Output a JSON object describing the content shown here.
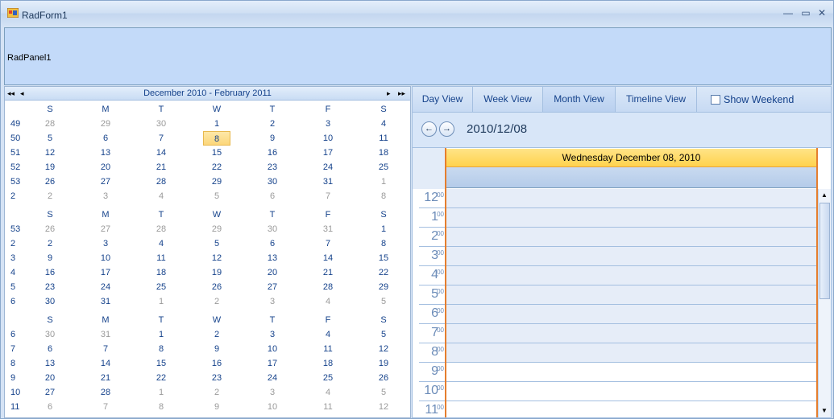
{
  "window": {
    "title": "RadForm1",
    "icons": {
      "app": "app-icon",
      "minimize": "minimize-icon",
      "maximize": "maximize-icon",
      "close": "close-icon"
    }
  },
  "panel": {
    "label": "RadPanel1"
  },
  "calendar": {
    "title": "December 2010 - February 2011",
    "nav": {
      "first": "◂◂",
      "prev": "◂",
      "next": "▸",
      "last": "▸▸"
    },
    "days_of_week": [
      "S",
      "M",
      "T",
      "W",
      "T",
      "F",
      "S"
    ],
    "months": [
      {
        "weeks": [
          {
            "wk": "49",
            "days": [
              [
                "28",
                1
              ],
              [
                "29",
                1
              ],
              [
                "30",
                1
              ],
              [
                "1",
                0
              ],
              [
                "2",
                0
              ],
              [
                "3",
                0
              ],
              [
                "4",
                0
              ]
            ]
          },
          {
            "wk": "50",
            "days": [
              [
                "5",
                0
              ],
              [
                "6",
                0
              ],
              [
                "7",
                0
              ],
              [
                "8",
                0
              ],
              [
                "9",
                0
              ],
              [
                "10",
                0
              ],
              [
                "11",
                0
              ]
            ]
          },
          {
            "wk": "51",
            "days": [
              [
                "12",
                0
              ],
              [
                "13",
                0
              ],
              [
                "14",
                0
              ],
              [
                "15",
                0
              ],
              [
                "16",
                0
              ],
              [
                "17",
                0
              ],
              [
                "18",
                0
              ]
            ]
          },
          {
            "wk": "52",
            "days": [
              [
                "19",
                0
              ],
              [
                "20",
                0
              ],
              [
                "21",
                0
              ],
              [
                "22",
                0
              ],
              [
                "23",
                0
              ],
              [
                "24",
                0
              ],
              [
                "25",
                0
              ]
            ]
          },
          {
            "wk": "53",
            "days": [
              [
                "26",
                0
              ],
              [
                "27",
                0
              ],
              [
                "28",
                0
              ],
              [
                "29",
                0
              ],
              [
                "30",
                0
              ],
              [
                "31",
                0
              ],
              [
                "1",
                1
              ]
            ]
          },
          {
            "wk": "2",
            "days": [
              [
                "2",
                1
              ],
              [
                "3",
                1
              ],
              [
                "4",
                1
              ],
              [
                "5",
                1
              ],
              [
                "6",
                1
              ],
              [
                "7",
                1
              ],
              [
                "8",
                1
              ]
            ]
          }
        ]
      },
      {
        "weeks": [
          {
            "wk": "53",
            "days": [
              [
                "26",
                1
              ],
              [
                "27",
                1
              ],
              [
                "28",
                1
              ],
              [
                "29",
                1
              ],
              [
                "30",
                1
              ],
              [
                "31",
                1
              ],
              [
                "1",
                0
              ]
            ]
          },
          {
            "wk": "2",
            "days": [
              [
                "2",
                0
              ],
              [
                "3",
                0
              ],
              [
                "4",
                0
              ],
              [
                "5",
                0
              ],
              [
                "6",
                0
              ],
              [
                "7",
                0
              ],
              [
                "8",
                0
              ]
            ]
          },
          {
            "wk": "3",
            "days": [
              [
                "9",
                0
              ],
              [
                "10",
                0
              ],
              [
                "11",
                0
              ],
              [
                "12",
                0
              ],
              [
                "13",
                0
              ],
              [
                "14",
                0
              ],
              [
                "15",
                0
              ]
            ]
          },
          {
            "wk": "4",
            "days": [
              [
                "16",
                0
              ],
              [
                "17",
                0
              ],
              [
                "18",
                0
              ],
              [
                "19",
                0
              ],
              [
                "20",
                0
              ],
              [
                "21",
                0
              ],
              [
                "22",
                0
              ]
            ]
          },
          {
            "wk": "5",
            "days": [
              [
                "23",
                0
              ],
              [
                "24",
                0
              ],
              [
                "25",
                0
              ],
              [
                "26",
                0
              ],
              [
                "27",
                0
              ],
              [
                "28",
                0
              ],
              [
                "29",
                0
              ]
            ]
          },
          {
            "wk": "6",
            "days": [
              [
                "30",
                0
              ],
              [
                "31",
                0
              ],
              [
                "1",
                1
              ],
              [
                "2",
                1
              ],
              [
                "3",
                1
              ],
              [
                "4",
                1
              ],
              [
                "5",
                1
              ]
            ]
          }
        ]
      },
      {
        "weeks": [
          {
            "wk": "6",
            "days": [
              [
                "30",
                1
              ],
              [
                "31",
                1
              ],
              [
                "1",
                0
              ],
              [
                "2",
                0
              ],
              [
                "3",
                0
              ],
              [
                "4",
                0
              ],
              [
                "5",
                0
              ]
            ]
          },
          {
            "wk": "7",
            "days": [
              [
                "6",
                0
              ],
              [
                "7",
                0
              ],
              [
                "8",
                0
              ],
              [
                "9",
                0
              ],
              [
                "10",
                0
              ],
              [
                "11",
                0
              ],
              [
                "12",
                0
              ]
            ]
          },
          {
            "wk": "8",
            "days": [
              [
                "13",
                0
              ],
              [
                "14",
                0
              ],
              [
                "15",
                0
              ],
              [
                "16",
                0
              ],
              [
                "17",
                0
              ],
              [
                "18",
                0
              ],
              [
                "19",
                0
              ]
            ]
          },
          {
            "wk": "9",
            "days": [
              [
                "20",
                0
              ],
              [
                "21",
                0
              ],
              [
                "22",
                0
              ],
              [
                "23",
                0
              ],
              [
                "24",
                0
              ],
              [
                "25",
                0
              ],
              [
                "26",
                0
              ]
            ]
          },
          {
            "wk": "10",
            "days": [
              [
                "27",
                0
              ],
              [
                "28",
                0
              ],
              [
                "1",
                1
              ],
              [
                "2",
                1
              ],
              [
                "3",
                1
              ],
              [
                "4",
                1
              ],
              [
                "5",
                1
              ]
            ]
          },
          {
            "wk": "11",
            "days": [
              [
                "6",
                1
              ],
              [
                "7",
                1
              ],
              [
                "8",
                1
              ],
              [
                "9",
                1
              ],
              [
                "10",
                1
              ],
              [
                "11",
                1
              ],
              [
                "12",
                1
              ]
            ]
          }
        ]
      }
    ],
    "selected_day": "8"
  },
  "scheduler": {
    "views": [
      "Day View",
      "Week View",
      "Month View",
      "Timeline View"
    ],
    "show_weekend_label": "Show Weekend",
    "show_weekend_checked": false,
    "nav": {
      "prev_icon": "arrow-left-icon",
      "next_icon": "arrow-right-icon",
      "prev": "←",
      "next": "→"
    },
    "date": "2010/12/08",
    "day_header": "Wednesday December 08, 2010",
    "hours": [
      "12",
      "1",
      "2",
      "3",
      "4",
      "5",
      "6",
      "7",
      "8",
      "9",
      "10",
      "11"
    ],
    "minutes_suffix": "00",
    "scroll": {
      "up": "▲",
      "down": "▼"
    }
  }
}
